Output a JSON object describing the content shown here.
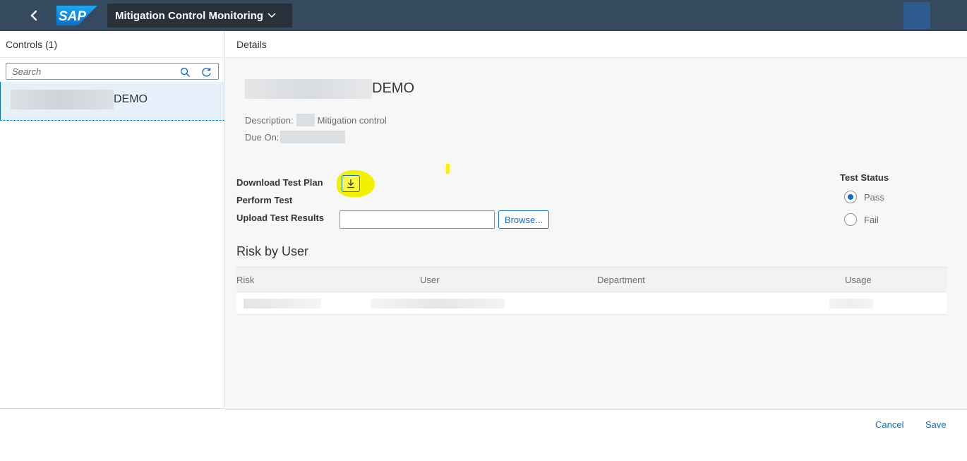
{
  "shell": {
    "logo_text": "SAP",
    "app_title": "Mitigation Control Monitoring"
  },
  "master": {
    "header": "Controls (1)",
    "search_placeholder": "Search",
    "items": [
      {
        "title_suffix": "DEMO"
      }
    ]
  },
  "detail": {
    "header": "Details",
    "object_title_suffix": "DEMO",
    "description_label": "Description:",
    "description_value": "Mitigation control",
    "due_label": "Due On:",
    "download_label": "Download Test Plan",
    "perform_label": "Perform Test",
    "upload_label": "Upload Test Results",
    "browse_label": "Browse...",
    "test_status": {
      "label": "Test Status",
      "options": [
        {
          "label": "Pass",
          "selected": true
        },
        {
          "label": "Fail",
          "selected": false
        }
      ]
    },
    "risk_section_title": "Risk by User",
    "table": {
      "columns": [
        "Risk",
        "User",
        "Department",
        "Usage"
      ]
    }
  },
  "footer": {
    "cancel_label": "Cancel",
    "save_label": "Save"
  },
  "colors": {
    "shell": "#354a5f",
    "accent": "#0a6ed1",
    "highlight": "#f3f000"
  },
  "icons": [
    "back-arrow-icon",
    "chevron-down-icon",
    "search-icon",
    "refresh-icon",
    "download-icon",
    "radio-icon"
  ]
}
